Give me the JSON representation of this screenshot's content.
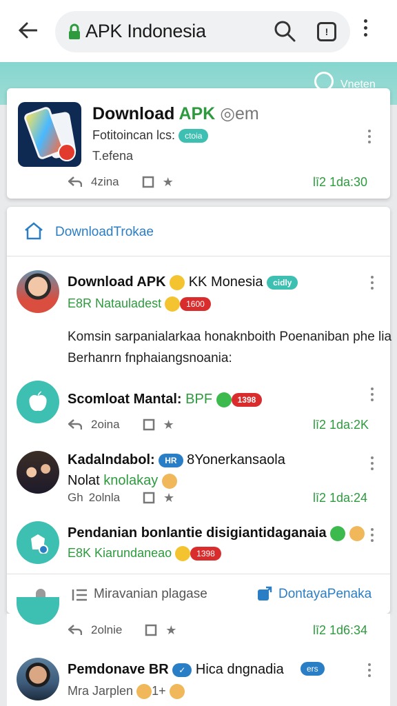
{
  "browser": {
    "url_text": "APK Indonesia",
    "tab_icon_label": "!"
  },
  "banner": {
    "text": "Vneten"
  },
  "app_card": {
    "title_prefix": "Download ",
    "title_green": "APK",
    "title_suffix": " ◎em",
    "subtitle": "Fotitoincan lcs:",
    "subtitle_badge": "ctoia",
    "line2": "T.efena",
    "reply_count": "4zina",
    "time": "lī2 1da:30"
  },
  "feed": {
    "header_label": "DownloadTrokae",
    "posts": [
      {
        "name": "Download APK",
        "name_suffix": " KK Monesia",
        "badge": "cidly",
        "meta": "E8R Natauladest",
        "meta_badge": "1600",
        "body": "Komsin sarpanialarkaa honaknboith Poenaniban phe lia Berhanrn fnphaiangsnoania:"
      },
      {
        "name": "Scomloat Mantal:",
        "name_suffix": " BPF",
        "meta_badge": "1398",
        "reply_count": "2oina",
        "time": "lī2 1da:2K"
      },
      {
        "name": "Kadalndabol:",
        "name_suffix": " 8Yonerkansaola",
        "name_badge": "HR",
        "line2": "Nolat",
        "line2_green": " knolakay",
        "reply_count": "2olnla",
        "reply_prefix": "Gh",
        "time": "lī2 1da:24"
      },
      {
        "name": "Pendanian bonlantie disigiantidaganaia",
        "meta": "E8K Kiarundaneao",
        "meta_badge": "1398"
      }
    ],
    "footer_left": "Miravanian plagase",
    "footer_right": "DontayaPenaka"
  },
  "below": {
    "reply_count": "2olnie",
    "time": "lī2 1d6:34",
    "next_name": "Pemdonave BR",
    "next_name_suffix": " Hica dngnadia",
    "next_badge": "ers",
    "next_meta": "Mra Jarplen",
    "next_meta_badge": "1+"
  },
  "colors": {
    "accent_green": "#2d9a3e",
    "accent_blue": "#2a7ec6",
    "teal": "#3dbfb2",
    "red": "#d92d2d"
  },
  "icons": [
    "back-arrow-icon",
    "lock-icon",
    "search-icon",
    "tabs-icon",
    "more-icon",
    "home-icon",
    "reply-icon",
    "repost-icon",
    "star-icon",
    "list-icon",
    "share-icon",
    "bell-icon"
  ]
}
